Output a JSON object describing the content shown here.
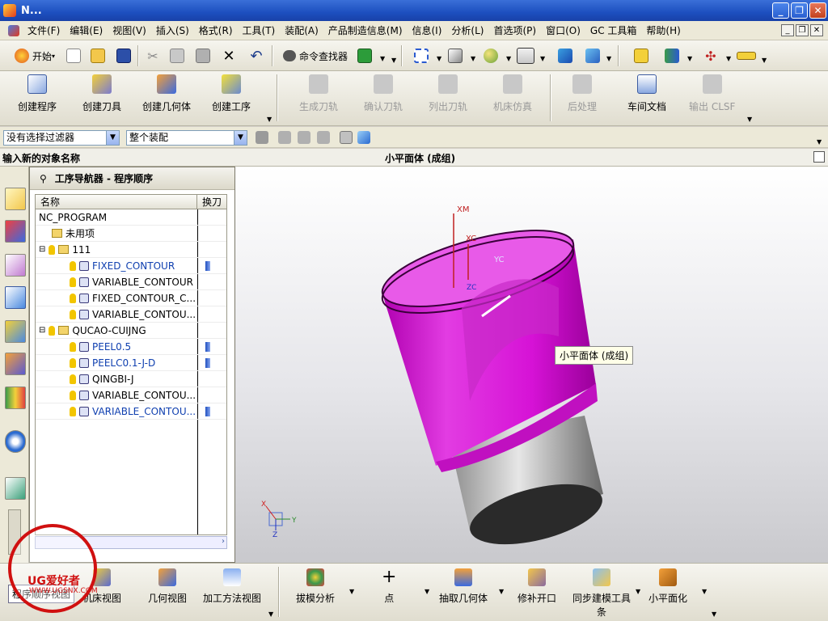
{
  "window": {
    "title": "N..."
  },
  "menu": [
    "文件(F)",
    "编辑(E)",
    "视图(V)",
    "插入(S)",
    "格式(R)",
    "工具(T)",
    "装配(A)",
    "产品制造信息(M)",
    "信息(I)",
    "分析(L)",
    "首选项(P)",
    "窗口(O)",
    "GC 工具箱",
    "帮助(H)"
  ],
  "std_toolbar": {
    "start": "开始",
    "command_finder": "命令查找器"
  },
  "cam_toolbar": {
    "create_program": "创建程序",
    "create_tool": "创建刀具",
    "create_geometry": "创建几何体",
    "create_operation": "创建工序",
    "generate_path": "生成刀轨",
    "verify_path": "确认刀轨",
    "list_path": "列出刀轨",
    "machine_sim": "机床仿真",
    "postprocess": "后处理",
    "shop_doc": "车间文档",
    "output_clsf": "输出 CLSF"
  },
  "filter": {
    "selection_filter": "没有选择过滤器",
    "assembly_scope": "整个装配"
  },
  "status": {
    "prompt": "输入新的对象名称",
    "selection": "小平面体 (成组)"
  },
  "navigator": {
    "title": "工序导航器 - 程序顺序",
    "col_name": "名称",
    "col_tool": "换刀",
    "rows": [
      {
        "name": "NC_PROGRAM"
      },
      {
        "name": "未用项"
      },
      {
        "name": "111"
      },
      {
        "name": "FIXED_CONTOUR"
      },
      {
        "name": "VARIABLE_CONTOUR"
      },
      {
        "name": "FIXED_CONTOUR_C..."
      },
      {
        "name": "VARIABLE_CONTOU..."
      },
      {
        "name": "QUCAO-CUIJNG"
      },
      {
        "name": "PEEL0.5"
      },
      {
        "name": "PEELC0.1-J-D"
      },
      {
        "name": "QINGBI-J"
      },
      {
        "name": "VARIABLE_CONTOU..."
      },
      {
        "name": "VARIABLE_CONTOU..."
      }
    ]
  },
  "viewport": {
    "tooltip": "小平面体 (成组)",
    "wcs_xm": "XM",
    "wcs_xc": "XC",
    "wcs_yc": "YC",
    "wcs_zc": "ZC",
    "triad_x": "X",
    "triad_y": "Y",
    "triad_z": "Z"
  },
  "bottom_toolbar": {
    "program_view": "程序顺序视图",
    "machine_view": "机床视图",
    "geometry_view": "几何视图",
    "method_view": "加工方法视图",
    "draft_analysis": "拔模分析",
    "point": "点",
    "extract_geometry": "抽取几何体",
    "patch_opening": "修补开口",
    "sync_modeling": "同步建模工具条",
    "small_facet": "小平面化"
  },
  "watermark": {
    "text": "UG爱好者",
    "url": "WWW.UGSNX.COM"
  },
  "colors": {
    "part": "#e011e0",
    "titlebar": "#1d4fbf"
  }
}
